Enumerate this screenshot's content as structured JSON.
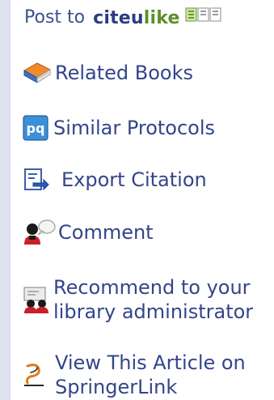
{
  "post": {
    "prefix": "Post to",
    "brand_part1": "citeu",
    "brand_part2": "like"
  },
  "links": {
    "related_books": "Related Books",
    "similar_protocols": "Similar Protocols",
    "export_citation": "Export Citation",
    "comment": "Comment",
    "recommend_line1": "Recommend to your",
    "recommend_line2": "library administrator",
    "springer_line1": "View This Article on",
    "springer_line2": "SpringerLink"
  },
  "icons": {
    "pq_text": "pq"
  },
  "colors": {
    "link": "#33458a",
    "brand_blue": "#2b3d82",
    "brand_green": "#5d8f2c",
    "sidebar": "#dfe3ef"
  }
}
